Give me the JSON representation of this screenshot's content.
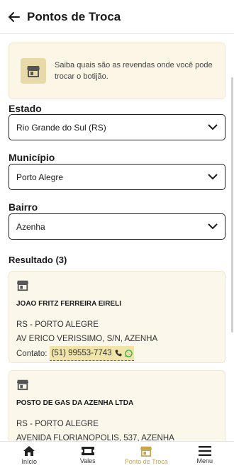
{
  "header": {
    "title": "Pontos de Troca"
  },
  "banner": {
    "text": "Saiba quais são as revendas onde você pode trocar o botijão."
  },
  "filters": {
    "state": {
      "label": "Estado",
      "value": "Rio Grande do Sul (RS)"
    },
    "city": {
      "label": "Município",
      "value": "Porto Alegre"
    },
    "district": {
      "label": "Bairro",
      "value": "Azenha"
    }
  },
  "results": {
    "label": "Resultado (3)",
    "items": [
      {
        "name": "JOAO FRITZ FERREIRA EIRELI",
        "location": "RS - PORTO ALEGRE",
        "address": "AV ERICO VERISSIMO,  S/N, AZENHA",
        "contact_label": "Contato:",
        "phone": "(51) 99553-7743"
      },
      {
        "name": "POSTO DE GAS DA AZENHA LTDA",
        "location": "RS - PORTO ALEGRE",
        "address": "AVENIDA FLORIANOPOLIS,  537, AZENHA"
      }
    ]
  },
  "nav": {
    "items": [
      {
        "label": "Início",
        "icon": "home-icon"
      },
      {
        "label": "Vales",
        "icon": "ticket-icon"
      },
      {
        "label": "Ponto de Troca",
        "icon": "store-icon"
      },
      {
        "label": "Menu",
        "icon": "menu-icon"
      }
    ],
    "active_color": "#c7a64a"
  }
}
